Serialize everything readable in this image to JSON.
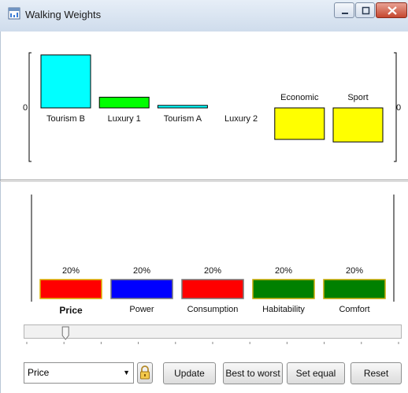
{
  "window": {
    "title": "Walking Weights",
    "buttons": [
      "minimize",
      "maximize",
      "close"
    ]
  },
  "top_chart": {
    "zero_label_left": "0",
    "zero_label_right": "0",
    "alternatives": [
      {
        "label": "Tourism B",
        "value": 0.84,
        "color": "#00ffff"
      },
      {
        "label": "Luxury 1",
        "value": 0.17,
        "color": "#00ff00"
      },
      {
        "label": "Tourism A",
        "value": 0.04,
        "color": "#00ffff"
      },
      {
        "label": "Luxury 2",
        "value": 0,
        "color": "#00ffff"
      },
      {
        "label": "Economic",
        "value": -0.5,
        "color": "#ffff00"
      },
      {
        "label": "Sport",
        "value": -0.54,
        "color": "#ffff00"
      }
    ]
  },
  "criteria_chart": {
    "criteria": [
      {
        "label": "Price",
        "percent": "20%",
        "value": 20,
        "color": "#ff0000",
        "selected": true
      },
      {
        "label": "Power",
        "percent": "20%",
        "value": 20,
        "color": "#0000ff",
        "selected": false
      },
      {
        "label": "Consumption",
        "percent": "20%",
        "value": 20,
        "color": "#ff0000",
        "selected": false
      },
      {
        "label": "Habitability",
        "percent": "20%",
        "value": 20,
        "color": "#008000",
        "selected": false
      },
      {
        "label": "Comfort",
        "percent": "20%",
        "value": 20,
        "color": "#008000",
        "selected": false
      }
    ]
  },
  "slider": {
    "value": 0.2
  },
  "controls": {
    "criterion_select": "Price",
    "update": "Update",
    "best_to_worst": "Best to worst",
    "set_equal": "Set equal",
    "reset": "Reset"
  },
  "icons": {
    "app": "window-app-icon",
    "lock": "lock-icon"
  }
}
